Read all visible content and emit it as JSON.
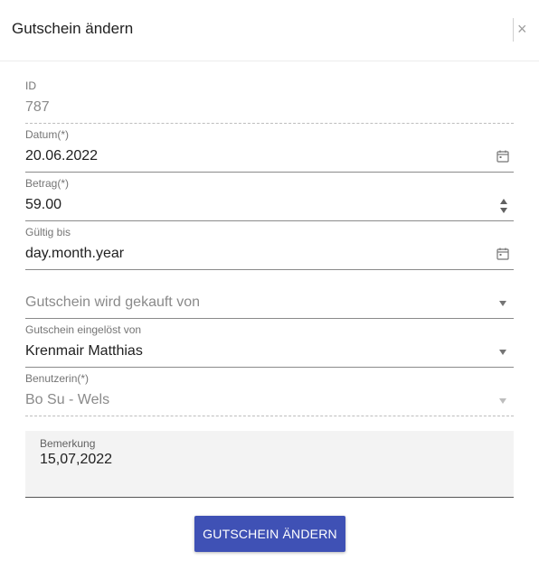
{
  "dialog": {
    "title": "Gutschein ändern",
    "close_label": "×"
  },
  "form": {
    "id": {
      "label": "ID",
      "value": "787"
    },
    "datum": {
      "label": "Datum(*)",
      "value": "20.06.2022",
      "icon": "calendar-icon"
    },
    "betrag": {
      "label": "Betrag(*)",
      "value": "59.00",
      "icon": "spinner-icon"
    },
    "gueltig_bis": {
      "label": "Gültig bis",
      "placeholder": "day.month.year",
      "icon": "calendar-icon"
    },
    "gekauft_von": {
      "placeholder": "Gutschein wird gekauft von"
    },
    "eingeloest_von": {
      "label": "Gutschein eingelöst von",
      "value": "Krenmair Matthias"
    },
    "benutzerin": {
      "label": "Benutzerin(*)",
      "value": "Bo Su - Wels"
    },
    "bemerkung": {
      "label": "Bemerkung",
      "value": "15,07,2022"
    }
  },
  "actions": {
    "submit_label": "GUTSCHEIN ÄNDERN"
  },
  "colors": {
    "primary": "#3f51b5"
  }
}
